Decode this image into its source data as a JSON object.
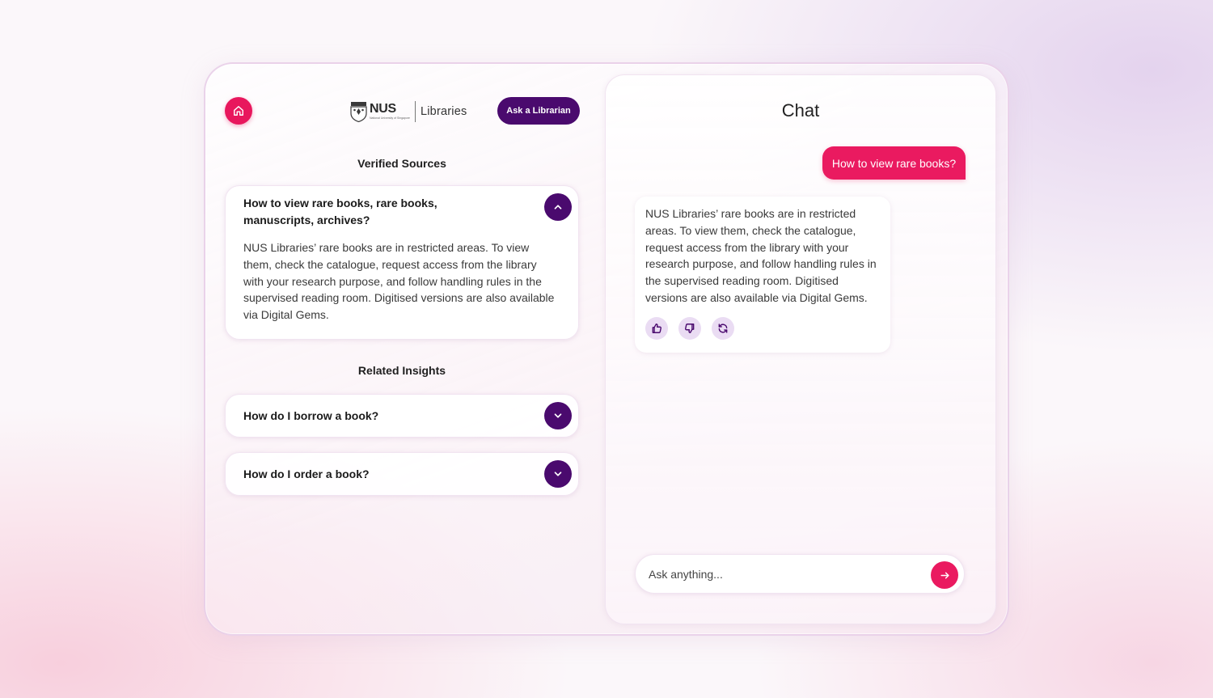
{
  "header": {
    "logo_main": "NUS",
    "logo_sub": "National University of Singapore",
    "logo_product": "Libraries",
    "ask_button_label": "Ask a Librarian"
  },
  "icons": {
    "home": "home-icon",
    "chevron_up": "chevron-up-icon",
    "chevron_down": "chevron-down-icon",
    "thumbs_up": "thumbs-up-icon",
    "thumbs_down": "thumbs-down-icon",
    "regenerate": "refresh-icon",
    "send": "arrow-right-icon"
  },
  "verified_sources": {
    "title": "Verified Sources",
    "items": [
      {
        "question": "How to view rare books, rare books, manuscripts, archives?",
        "answer": "NUS Libraries’ rare books are in restricted areas. To view them, check the catalogue, request access from the library with your research purpose, and follow handling rules in the supervised reading room. Digitised versions are also available via Digital Gems.",
        "expanded": true
      }
    ]
  },
  "related_insights": {
    "title": "Related Insights",
    "items": [
      {
        "question": "How do I borrow a book?",
        "expanded": false
      },
      {
        "question": "How do I order a book?",
        "expanded": false
      }
    ]
  },
  "chat": {
    "title": "Chat",
    "messages": [
      {
        "role": "user",
        "text": "How to view rare books?"
      },
      {
        "role": "assistant",
        "text": "NUS Libraries’ rare books are in restricted areas. To view them, check the catalogue, request access from the library with your research purpose, and follow handling rules in the supervised reading room. Digitised versions are also available via Digital Gems."
      }
    ],
    "input_placeholder": "Ask anything..."
  },
  "colors": {
    "accent_pink": "#ea1a60",
    "accent_purple": "#4a0a6e",
    "feedback_bg": "#eadcf3"
  }
}
